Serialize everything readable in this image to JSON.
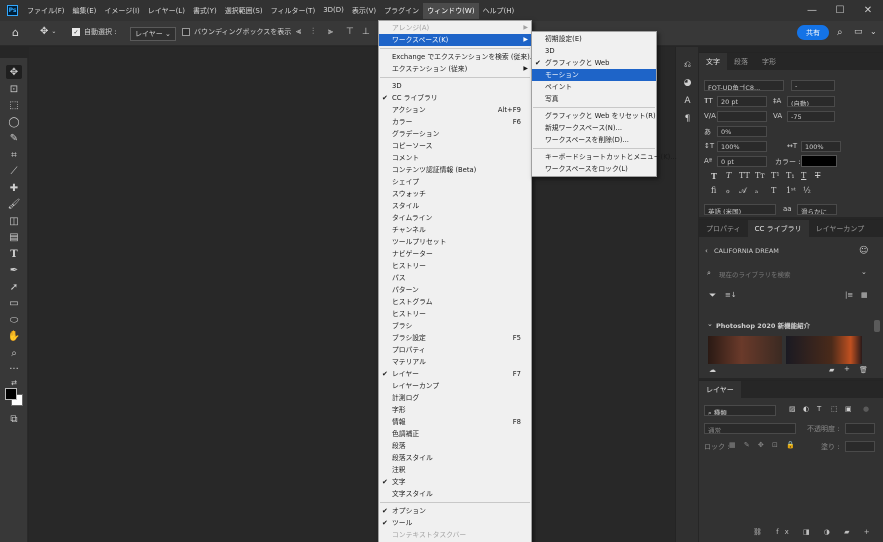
{
  "app": {
    "logo": "Ps",
    "menus": [
      "ファイル(F)",
      "編集(E)",
      "イメージ(I)",
      "レイヤー(L)",
      "書式(Y)",
      "選択範囲(S)",
      "フィルター(T)",
      "3D(D)",
      "表示(V)",
      "プラグイン",
      "ウィンドウ(W)",
      "ヘルプ(H)"
    ],
    "active_menu_index": 10
  },
  "options_bar": {
    "auto_select_label": "自動選択 :",
    "auto_select_checked": true,
    "layer_dropdown": "レイヤー",
    "bounding_box_label": "バウンディングボックスを表示",
    "bounding_box_checked": false,
    "share_label": "共有"
  },
  "window_menu": {
    "items": [
      {
        "label": "アレンジ(A)",
        "disabled": true,
        "submenu": true
      },
      {
        "label": "ワークスペース(K)",
        "highlighted": true,
        "submenu": true
      },
      {
        "sep": true
      },
      {
        "label": "Exchange でエクステンションを検索 (従来)..."
      },
      {
        "label": "エクステンション (従来)",
        "submenu": true
      },
      {
        "sep": true
      },
      {
        "label": "3D"
      },
      {
        "label": "CC ライブラリ",
        "checked": true
      },
      {
        "label": "アクション",
        "shortcut": "Alt+F9"
      },
      {
        "label": "カラー",
        "shortcut": "F6"
      },
      {
        "label": "グラデーション"
      },
      {
        "label": "コピーソース"
      },
      {
        "label": "コメント"
      },
      {
        "label": "コンテンツ認証情報 (Beta)"
      },
      {
        "label": "シェイプ"
      },
      {
        "label": "スウォッチ"
      },
      {
        "label": "スタイル"
      },
      {
        "label": "タイムライン"
      },
      {
        "label": "チャンネル"
      },
      {
        "label": "ツールプリセット"
      },
      {
        "label": "ナビゲーター"
      },
      {
        "label": "ヒストリー"
      },
      {
        "label": "パス"
      },
      {
        "label": "パターン"
      },
      {
        "label": "ヒストグラム"
      },
      {
        "label": "ヒストリー"
      },
      {
        "label": "ブラシ"
      },
      {
        "label": "ブラシ設定",
        "shortcut": "F5"
      },
      {
        "label": "プロパティ"
      },
      {
        "label": "マテリアル"
      },
      {
        "label": "レイヤー",
        "checked": true,
        "shortcut": "F7"
      },
      {
        "label": "レイヤーカンプ"
      },
      {
        "label": "計測ログ"
      },
      {
        "label": "字形"
      },
      {
        "label": "情報",
        "shortcut": "F8"
      },
      {
        "label": "色調補正"
      },
      {
        "label": "段落"
      },
      {
        "label": "段落スタイル"
      },
      {
        "label": "注釈"
      },
      {
        "label": "文字",
        "checked": true
      },
      {
        "label": "文字スタイル"
      },
      {
        "sep": true
      },
      {
        "label": "オプション",
        "checked": true
      },
      {
        "label": "ツール",
        "checked": true
      },
      {
        "label": "コンテキストタスクバー",
        "disabled": true
      }
    ]
  },
  "workspace_submenu": {
    "items": [
      {
        "label": "初期設定(E)"
      },
      {
        "label": "3D"
      },
      {
        "label": "グラフィックと Web",
        "checked": true
      },
      {
        "label": "モーション",
        "highlighted": true
      },
      {
        "label": "ペイント"
      },
      {
        "label": "写真"
      },
      {
        "sep": true
      },
      {
        "label": "グラフィックと Web をリセット(R)"
      },
      {
        "label": "新規ワークスペース(N)..."
      },
      {
        "label": "ワークスペースを削除(D)..."
      },
      {
        "sep": true
      },
      {
        "label": "キーボードショートカットとメニュー(K)..."
      },
      {
        "label": "ワークスペースをロック(L)"
      }
    ]
  },
  "character_panel": {
    "tabs": [
      "文字",
      "段落",
      "字形"
    ],
    "font_family": "FOT-UD角ゴC8...",
    "font_style": "-",
    "size": "20 pt",
    "leading": "(自動)",
    "kerning": "",
    "tracking": "-75",
    "tsume": "0%",
    "vscale": "100%",
    "hscale": "100%",
    "baseline": "0 pt",
    "color_label": "カラー :",
    "color": "#000000",
    "language": "英語 (米国)",
    "antialias": "滑らかに"
  },
  "library_panel": {
    "tabs": [
      "プロパティ",
      "CC ライブラリ",
      "レイヤーカンプ"
    ],
    "library_name": "CALIFORNIA DREAM",
    "search_placeholder": "現在のライブラリを検索",
    "section_title": "Photoshop 2020 新機能紹介"
  },
  "layers_panel": {
    "tabs": [
      "レイヤー"
    ],
    "filter_label": "種類",
    "blend_mode": "通常",
    "opacity_label": "不透明度 :",
    "lock_label": "ロック :",
    "fill_label": "塗り :"
  }
}
